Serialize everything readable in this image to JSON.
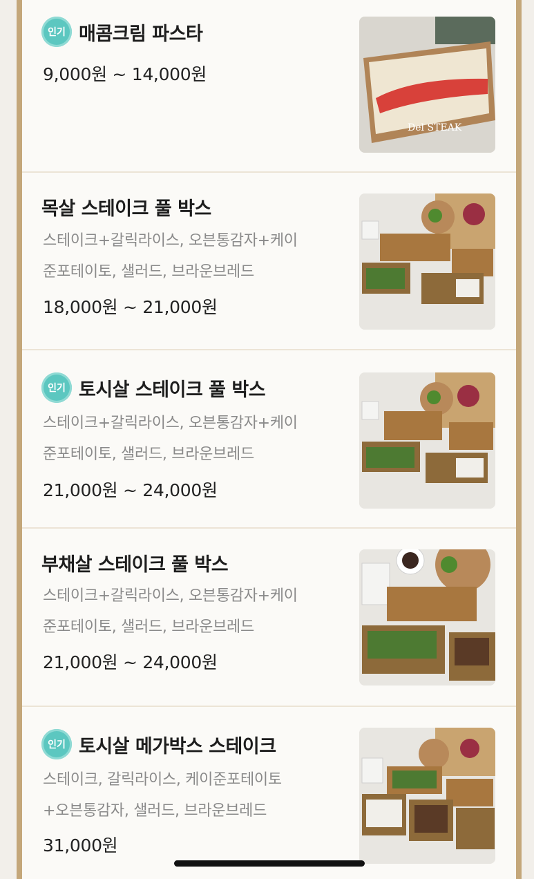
{
  "badge_label": "인기",
  "items": [
    {
      "title": "매콤크림 파스타",
      "desc_line1": "",
      "desc_line2": "",
      "price": "9,000원 ~ 14,000원",
      "popular": true
    },
    {
      "title": "목살 스테이크 풀 박스",
      "desc_line1": "스테이크+갈릭라이스, 오븐통감자+케이",
      "desc_line2": "준포테이토, 샐러드, 브라운브레드",
      "price": "18,000원 ~ 21,000원",
      "popular": false
    },
    {
      "title": "토시살 스테이크 풀 박스",
      "desc_line1": "스테이크+갈릭라이스, 오븐통감자+케이",
      "desc_line2": "준포테이토, 샐러드, 브라운브레드",
      "price": "21,000원 ~ 24,000원",
      "popular": true
    },
    {
      "title": "부채살 스테이크 풀 박스",
      "desc_line1": "스테이크+갈릭라이스, 오븐통감자+케이",
      "desc_line2": "준포테이토, 샐러드, 브라운브레드",
      "price": "21,000원 ~ 24,000원",
      "popular": false
    },
    {
      "title": "토시살 메가박스 스테이크",
      "desc_line1": "스테이크, 갈릭라이스, 케이준포테이토",
      "desc_line2": "+오븐통감자, 샐러드, 브라운브레드",
      "price": "31,000원",
      "popular": true
    }
  ],
  "colors": {
    "badge": "#5cc7c0",
    "rail": "#c4a77a",
    "title": "#1d1d1d",
    "desc": "#8a8a8a"
  }
}
